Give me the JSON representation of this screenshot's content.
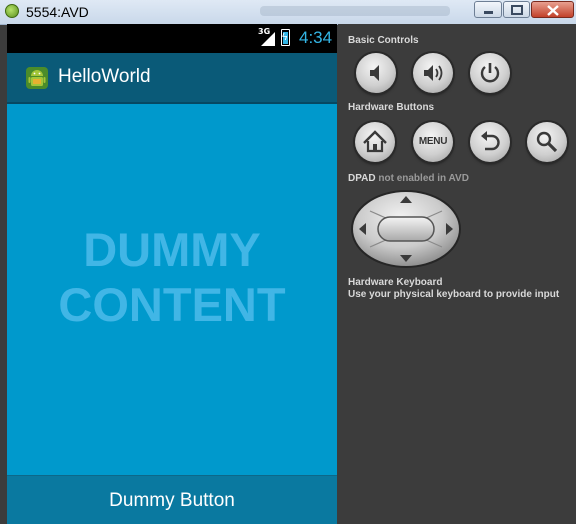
{
  "window": {
    "title": "5554:AVD"
  },
  "device": {
    "status_bar": {
      "network": "3G",
      "time": "4:34"
    },
    "action_bar": {
      "app_title": "HelloWorld",
      "app_icon": "android-icon"
    },
    "content": {
      "line1": "DUMMY",
      "line2": "CONTENT"
    },
    "bottom_button": {
      "label": "Dummy Button"
    }
  },
  "panel": {
    "basic_controls": {
      "label": "Basic Controls",
      "buttons": [
        "volume-down-icon",
        "volume-up-icon",
        "power-icon"
      ]
    },
    "hardware_buttons": {
      "label": "Hardware Buttons",
      "buttons": [
        "home-icon",
        "menu-icon",
        "back-icon",
        "search-icon"
      ],
      "menu_label": "MENU"
    },
    "dpad": {
      "label": "DPAD",
      "note": "not enabled in AVD"
    },
    "hardware_keyboard": {
      "label": "Hardware Keyboard",
      "description": "Use your physical keyboard to provide input"
    }
  },
  "colors": {
    "screen_bg": "#0099cc",
    "action_bar": "#0a5a78",
    "dummy_text": "#41b6e6",
    "panel_bg": "#3c3c3c",
    "clock": "#33b5e5"
  }
}
